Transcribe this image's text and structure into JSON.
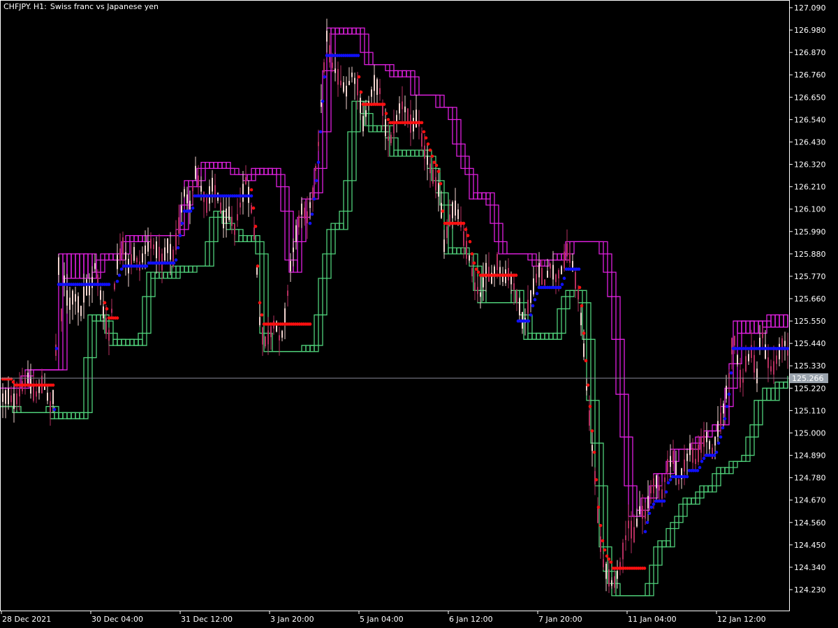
{
  "header": {
    "symbol": "CHFJPY.",
    "timeframe": "H1:",
    "description": "Swiss franc vs Japanese yen"
  },
  "colors": {
    "background": "#000000",
    "frame": "#ffffff",
    "candle_bull": "#f2d4cf",
    "candle_bear": "#b52f5f",
    "upper_band": "#e020e0",
    "lower_band": "#4fd07a",
    "stop_up": "#1010ff",
    "stop_down": "#ff1010",
    "current_price_line": "#8a8a9a",
    "current_price_tag": "#9aa3ad"
  },
  "chart_data": {
    "type": "candlestick",
    "ylim": [
      124.16,
      127.093
    ],
    "y_ticks": [
      "127.090",
      "126.980",
      "126.870",
      "126.760",
      "126.650",
      "126.540",
      "126.430",
      "126.320",
      "126.210",
      "126.100",
      "125.990",
      "125.880",
      "125.770",
      "125.660",
      "125.550",
      "125.440",
      "125.330",
      "125.220",
      "125.110",
      "125.000",
      "124.890",
      "124.780",
      "124.670",
      "124.560",
      "124.450",
      "124.340",
      "124.230"
    ],
    "x_labels": [
      "28 Dec 2021",
      "30 Dec 04:00",
      "31 Dec 12:00",
      "3 Jan 20:00",
      "5 Jan 04:00",
      "6 Jan 12:00",
      "7 Jan 20:00",
      "11 Jan 04:00",
      "12 Jan 12:00"
    ],
    "current_price": "125.266",
    "trend_path": [
      [
        0,
        125.17
      ],
      [
        12,
        125.18
      ],
      [
        22,
        125.15
      ],
      [
        30,
        125.22
      ],
      [
        40,
        125.27
      ],
      [
        50,
        125.18
      ],
      [
        62,
        125.25
      ],
      [
        72,
        125.13
      ],
      [
        78,
        125.2
      ],
      [
        84,
        125.82
      ],
      [
        88,
        125.58
      ],
      [
        92,
        125.75
      ],
      [
        98,
        125.62
      ],
      [
        106,
        125.68
      ],
      [
        116,
        125.6
      ],
      [
        122,
        125.72
      ],
      [
        130,
        125.7
      ],
      [
        136,
        125.82
      ],
      [
        142,
        125.72
      ],
      [
        150,
        125.55
      ],
      [
        156,
        125.48
      ],
      [
        162,
        125.66
      ],
      [
        168,
        125.84
      ],
      [
        176,
        125.92
      ],
      [
        184,
        125.82
      ],
      [
        192,
        125.88
      ],
      [
        200,
        125.82
      ],
      [
        208,
        125.9
      ],
      [
        216,
        125.93
      ],
      [
        224,
        125.9
      ],
      [
        232,
        125.84
      ],
      [
        240,
        125.92
      ],
      [
        248,
        125.86
      ],
      [
        256,
        126.02
      ],
      [
        264,
        126.18
      ],
      [
        272,
        126.12
      ],
      [
        280,
        126.28
      ],
      [
        288,
        126.2
      ],
      [
        296,
        126.12
      ],
      [
        304,
        126.22
      ],
      [
        312,
        126.16
      ],
      [
        320,
        126.05
      ],
      [
        328,
        126.08
      ],
      [
        336,
        126.0
      ],
      [
        344,
        126.12
      ],
      [
        352,
        126.24
      ],
      [
        360,
        126.1
      ],
      [
        366,
        125.92
      ],
      [
        372,
        125.55
      ],
      [
        378,
        125.44
      ],
      [
        386,
        125.48
      ],
      [
        394,
        125.55
      ],
      [
        402,
        125.44
      ],
      [
        410,
        125.62
      ],
      [
        416,
        125.82
      ],
      [
        424,
        125.98
      ],
      [
        432,
        126.1
      ],
      [
        440,
        126.06
      ],
      [
        448,
        126.18
      ],
      [
        456,
        126.42
      ],
      [
        462,
        126.72
      ],
      [
        468,
        126.95
      ],
      [
        474,
        126.82
      ],
      [
        480,
        126.78
      ],
      [
        488,
        126.72
      ],
      [
        496,
        126.68
      ],
      [
        504,
        126.76
      ],
      [
        512,
        126.7
      ],
      [
        520,
        126.52
      ],
      [
        528,
        126.62
      ],
      [
        536,
        126.72
      ],
      [
        544,
        126.68
      ],
      [
        552,
        126.5
      ],
      [
        558,
        126.42
      ],
      [
        566,
        126.52
      ],
      [
        574,
        126.62
      ],
      [
        582,
        126.58
      ],
      [
        590,
        126.5
      ],
      [
        598,
        126.56
      ],
      [
        606,
        126.4
      ],
      [
        614,
        126.32
      ],
      [
        622,
        126.24
      ],
      [
        630,
        126.18
      ],
      [
        636,
        125.92
      ],
      [
        642,
        126.02
      ],
      [
        650,
        126.12
      ],
      [
        658,
        126.06
      ],
      [
        666,
        125.92
      ],
      [
        672,
        125.86
      ],
      [
        680,
        125.72
      ],
      [
        688,
        125.68
      ],
      [
        696,
        125.8
      ],
      [
        704,
        125.76
      ],
      [
        712,
        125.84
      ],
      [
        720,
        125.76
      ],
      [
        728,
        125.78
      ],
      [
        736,
        125.72
      ],
      [
        744,
        125.62
      ],
      [
        750,
        125.52
      ],
      [
        756,
        125.62
      ],
      [
        764,
        125.72
      ],
      [
        772,
        125.8
      ],
      [
        780,
        125.74
      ],
      [
        788,
        125.82
      ],
      [
        796,
        125.76
      ],
      [
        804,
        125.8
      ],
      [
        812,
        125.9
      ],
      [
        820,
        125.82
      ],
      [
        828,
        125.68
      ],
      [
        834,
        125.5
      ],
      [
        840,
        125.22
      ],
      [
        846,
        125.0
      ],
      [
        852,
        124.78
      ],
      [
        858,
        124.5
      ],
      [
        864,
        124.36
      ],
      [
        870,
        124.3
      ],
      [
        878,
        124.25
      ],
      [
        886,
        124.32
      ],
      [
        892,
        124.42
      ],
      [
        900,
        124.55
      ],
      [
        908,
        124.5
      ],
      [
        916,
        124.62
      ],
      [
        924,
        124.6
      ],
      [
        932,
        124.72
      ],
      [
        940,
        124.76
      ],
      [
        948,
        124.7
      ],
      [
        956,
        124.84
      ],
      [
        964,
        124.88
      ],
      [
        972,
        124.76
      ],
      [
        980,
        124.84
      ],
      [
        988,
        124.92
      ],
      [
        996,
        124.86
      ],
      [
        1004,
        124.94
      ],
      [
        1012,
        124.98
      ],
      [
        1020,
        124.9
      ],
      [
        1028,
        125.02
      ],
      [
        1036,
        125.12
      ],
      [
        1044,
        125.28
      ],
      [
        1050,
        125.5
      ],
      [
        1056,
        125.36
      ],
      [
        1062,
        125.22
      ],
      [
        1068,
        125.34
      ],
      [
        1076,
        125.4
      ],
      [
        1084,
        125.28
      ],
      [
        1090,
        125.52
      ],
      [
        1098,
        125.36
      ],
      [
        1106,
        125.3
      ],
      [
        1114,
        125.38
      ],
      [
        1122,
        125.46
      ],
      [
        1128,
        125.4
      ]
    ]
  }
}
